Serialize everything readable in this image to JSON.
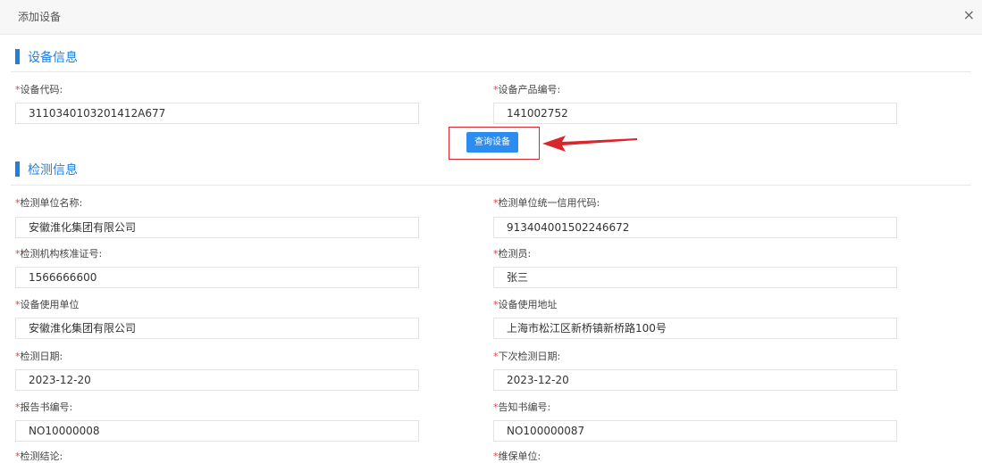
{
  "dialog": {
    "title": "添加设备",
    "close_glyph": "×"
  },
  "sections": {
    "device_info": "设备信息",
    "inspection_info": "检测信息"
  },
  "fields": {
    "device_code": {
      "label": "设备代码:",
      "value": "3110340103201412A677"
    },
    "product_no": {
      "label": "设备产品编号:",
      "value": "141002752"
    },
    "unit_name": {
      "label": "检测单位名称:",
      "value": "安徽淮化集团有限公司"
    },
    "credit_code": {
      "label": "检测单位统一信用代码:",
      "value": "913404001502246672"
    },
    "license_no": {
      "label": "检测机构核准证号:",
      "value": "1566666600"
    },
    "inspector": {
      "label": "检测员:",
      "value": "张三"
    },
    "user_unit": {
      "label": "设备使用单位",
      "value": "安徽淮化集团有限公司"
    },
    "user_address": {
      "label": "设备使用地址",
      "value": "上海市松江区新桥镇新桥路100号"
    },
    "inspect_date": {
      "label": "检测日期:",
      "value": "2023-12-20"
    },
    "next_date": {
      "label": "下次检测日期:",
      "value": "2023-12-20"
    },
    "report_no": {
      "label": "报告书编号:",
      "value": "NO10000008"
    },
    "notice_no": {
      "label": "告知书编号:",
      "value": "NO100000087"
    },
    "conclusion": {
      "label": "检测结论:"
    },
    "maintenance_unit": {
      "label": "维保单位:"
    }
  },
  "required_mark": "*",
  "query_button": "查询设备",
  "colors": {
    "accent": "#1e7fe0",
    "button": "#2d8cf0",
    "required": "#e64242",
    "highlight": "#d9262c"
  }
}
